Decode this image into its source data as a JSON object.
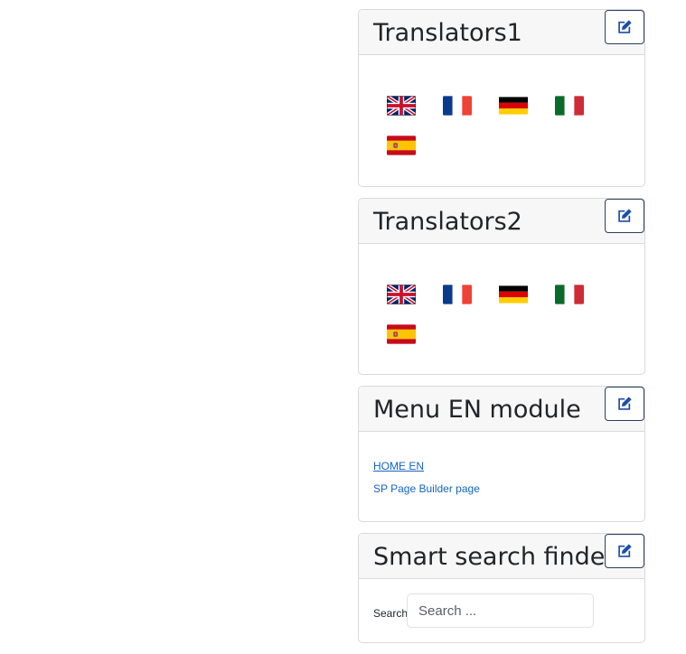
{
  "modules": [
    {
      "title": "Translators1",
      "edit_icon": "edit-icon",
      "flags": [
        "flag-uk-icon",
        "flag-france-icon",
        "flag-germany-icon",
        "flag-italy-icon",
        "flag-spain-icon"
      ]
    },
    {
      "title": "Translators2",
      "edit_icon": "edit-icon",
      "flags": [
        "flag-uk-icon",
        "flag-france-icon",
        "flag-germany-icon",
        "flag-italy-icon",
        "flag-spain-icon"
      ]
    },
    {
      "title": "Menu EN module",
      "edit_icon": "edit-icon",
      "links": [
        "HOME EN",
        "SP Page Builder page"
      ]
    },
    {
      "title": "Smart search finder",
      "edit_icon": "edit-icon",
      "search_label": "Search",
      "search_placeholder": "Search ..."
    }
  ],
  "colors": {
    "edit_icon": "#1d4fa6",
    "link": "#1565c0",
    "header_bg": "#f7f7f7"
  }
}
